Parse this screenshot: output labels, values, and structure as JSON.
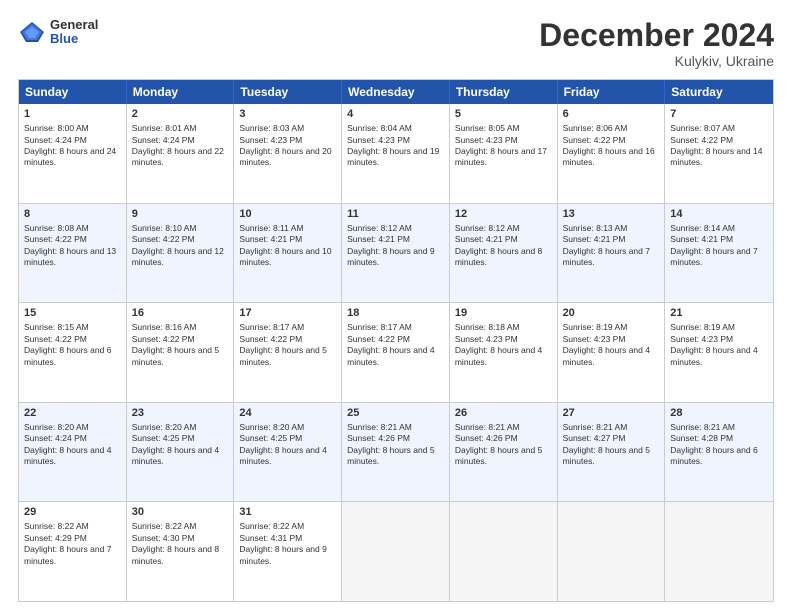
{
  "logo": {
    "general": "General",
    "blue": "Blue"
  },
  "header": {
    "month": "December 2024",
    "location": "Kulykiv, Ukraine"
  },
  "days": [
    "Sunday",
    "Monday",
    "Tuesday",
    "Wednesday",
    "Thursday",
    "Friday",
    "Saturday"
  ],
  "weeks": [
    [
      {
        "day": "1",
        "sunrise": "8:00 AM",
        "sunset": "4:24 PM",
        "daylight": "8 hours and 24 minutes."
      },
      {
        "day": "2",
        "sunrise": "8:01 AM",
        "sunset": "4:24 PM",
        "daylight": "8 hours and 22 minutes."
      },
      {
        "day": "3",
        "sunrise": "8:03 AM",
        "sunset": "4:23 PM",
        "daylight": "8 hours and 20 minutes."
      },
      {
        "day": "4",
        "sunrise": "8:04 AM",
        "sunset": "4:23 PM",
        "daylight": "8 hours and 19 minutes."
      },
      {
        "day": "5",
        "sunrise": "8:05 AM",
        "sunset": "4:23 PM",
        "daylight": "8 hours and 17 minutes."
      },
      {
        "day": "6",
        "sunrise": "8:06 AM",
        "sunset": "4:22 PM",
        "daylight": "8 hours and 16 minutes."
      },
      {
        "day": "7",
        "sunrise": "8:07 AM",
        "sunset": "4:22 PM",
        "daylight": "8 hours and 14 minutes."
      }
    ],
    [
      {
        "day": "8",
        "sunrise": "8:08 AM",
        "sunset": "4:22 PM",
        "daylight": "8 hours and 13 minutes."
      },
      {
        "day": "9",
        "sunrise": "8:10 AM",
        "sunset": "4:22 PM",
        "daylight": "8 hours and 12 minutes."
      },
      {
        "day": "10",
        "sunrise": "8:11 AM",
        "sunset": "4:21 PM",
        "daylight": "8 hours and 10 minutes."
      },
      {
        "day": "11",
        "sunrise": "8:12 AM",
        "sunset": "4:21 PM",
        "daylight": "8 hours and 9 minutes."
      },
      {
        "day": "12",
        "sunrise": "8:12 AM",
        "sunset": "4:21 PM",
        "daylight": "8 hours and 8 minutes."
      },
      {
        "day": "13",
        "sunrise": "8:13 AM",
        "sunset": "4:21 PM",
        "daylight": "8 hours and 7 minutes."
      },
      {
        "day": "14",
        "sunrise": "8:14 AM",
        "sunset": "4:21 PM",
        "daylight": "8 hours and 7 minutes."
      }
    ],
    [
      {
        "day": "15",
        "sunrise": "8:15 AM",
        "sunset": "4:22 PM",
        "daylight": "8 hours and 6 minutes."
      },
      {
        "day": "16",
        "sunrise": "8:16 AM",
        "sunset": "4:22 PM",
        "daylight": "8 hours and 5 minutes."
      },
      {
        "day": "17",
        "sunrise": "8:17 AM",
        "sunset": "4:22 PM",
        "daylight": "8 hours and 5 minutes."
      },
      {
        "day": "18",
        "sunrise": "8:17 AM",
        "sunset": "4:22 PM",
        "daylight": "8 hours and 4 minutes."
      },
      {
        "day": "19",
        "sunrise": "8:18 AM",
        "sunset": "4:23 PM",
        "daylight": "8 hours and 4 minutes."
      },
      {
        "day": "20",
        "sunrise": "8:19 AM",
        "sunset": "4:23 PM",
        "daylight": "8 hours and 4 minutes."
      },
      {
        "day": "21",
        "sunrise": "8:19 AM",
        "sunset": "4:23 PM",
        "daylight": "8 hours and 4 minutes."
      }
    ],
    [
      {
        "day": "22",
        "sunrise": "8:20 AM",
        "sunset": "4:24 PM",
        "daylight": "8 hours and 4 minutes."
      },
      {
        "day": "23",
        "sunrise": "8:20 AM",
        "sunset": "4:25 PM",
        "daylight": "8 hours and 4 minutes."
      },
      {
        "day": "24",
        "sunrise": "8:20 AM",
        "sunset": "4:25 PM",
        "daylight": "8 hours and 4 minutes."
      },
      {
        "day": "25",
        "sunrise": "8:21 AM",
        "sunset": "4:26 PM",
        "daylight": "8 hours and 5 minutes."
      },
      {
        "day": "26",
        "sunrise": "8:21 AM",
        "sunset": "4:26 PM",
        "daylight": "8 hours and 5 minutes."
      },
      {
        "day": "27",
        "sunrise": "8:21 AM",
        "sunset": "4:27 PM",
        "daylight": "8 hours and 5 minutes."
      },
      {
        "day": "28",
        "sunrise": "8:21 AM",
        "sunset": "4:28 PM",
        "daylight": "8 hours and 6 minutes."
      }
    ],
    [
      {
        "day": "29",
        "sunrise": "8:22 AM",
        "sunset": "4:29 PM",
        "daylight": "8 hours and 7 minutes."
      },
      {
        "day": "30",
        "sunrise": "8:22 AM",
        "sunset": "4:30 PM",
        "daylight": "8 hours and 8 minutes."
      },
      {
        "day": "31",
        "sunrise": "8:22 AM",
        "sunset": "4:31 PM",
        "daylight": "8 hours and 9 minutes."
      },
      null,
      null,
      null,
      null
    ]
  ]
}
